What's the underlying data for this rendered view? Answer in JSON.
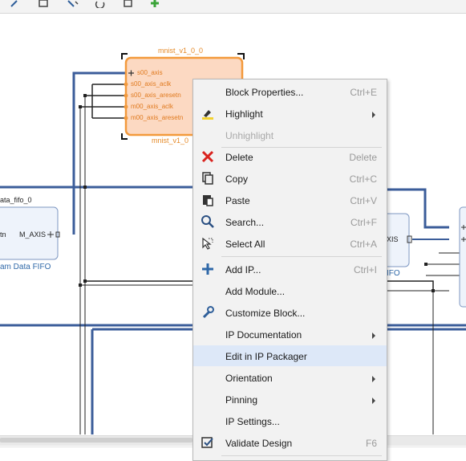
{
  "ip_block": {
    "title": "mnist_v1_0_0",
    "caption": "mnist_v1_0",
    "ports": [
      "s00_axis",
      "s00_axis_aclk",
      "s00_axis_aresetn",
      "m00_axis_aclk",
      "m00_axis_aresetn"
    ]
  },
  "fifo_block": {
    "title": "ata_fifo_0",
    "left_port": "tn",
    "right_port": "M_AXIS",
    "caption": "am Data FIFO"
  },
  "right_block": {
    "port": "XIS",
    "caption": "IFO"
  },
  "context_menu": {
    "items": [
      {
        "label": "Block Properties...",
        "shortcut": "Ctrl+E",
        "icon": "none",
        "enabled": true
      },
      {
        "label": "Highlight",
        "shortcut": "",
        "icon": "highlight-pen-icon",
        "enabled": true,
        "submenu": true
      },
      {
        "label": "Unhighlight",
        "shortcut": "",
        "icon": "none",
        "enabled": false
      },
      {
        "label": "Delete",
        "shortcut": "Delete",
        "icon": "delete-x-icon",
        "enabled": true
      },
      {
        "label": "Copy",
        "shortcut": "Ctrl+C",
        "icon": "copy-icon",
        "enabled": true
      },
      {
        "label": "Paste",
        "shortcut": "Ctrl+V",
        "icon": "paste-icon",
        "enabled": true
      },
      {
        "label": "Search...",
        "shortcut": "Ctrl+F",
        "icon": "search-icon",
        "enabled": true
      },
      {
        "label": "Select All",
        "shortcut": "Ctrl+A",
        "icon": "select-all-icon",
        "enabled": true
      },
      {
        "label": "Add IP...",
        "shortcut": "Ctrl+I",
        "icon": "plus-icon",
        "enabled": true
      },
      {
        "label": "Add Module...",
        "shortcut": "",
        "icon": "none",
        "enabled": true
      },
      {
        "label": "Customize Block...",
        "shortcut": "",
        "icon": "wrench-icon",
        "enabled": true
      },
      {
        "label": "IP Documentation",
        "shortcut": "",
        "icon": "none",
        "enabled": true,
        "submenu": true
      },
      {
        "label": "Edit in IP Packager",
        "shortcut": "",
        "icon": "none",
        "enabled": true,
        "highlighted": true
      },
      {
        "label": "Orientation",
        "shortcut": "",
        "icon": "none",
        "enabled": true,
        "submenu": true
      },
      {
        "label": "Pinning",
        "shortcut": "",
        "icon": "none",
        "enabled": true,
        "submenu": true
      },
      {
        "label": "IP Settings...",
        "shortcut": "",
        "icon": "none",
        "enabled": true
      },
      {
        "label": "Validate Design",
        "shortcut": "F6",
        "icon": "validate-check-icon",
        "enabled": true
      }
    ]
  },
  "colors": {
    "wire": "#3b5d9a",
    "ip_fill": "#fcd9c2",
    "ip_border": "#f39a3c",
    "menu_highlight": "#dde8f8",
    "delete_red": "#d9231e",
    "add_blue": "#2f68a8"
  }
}
